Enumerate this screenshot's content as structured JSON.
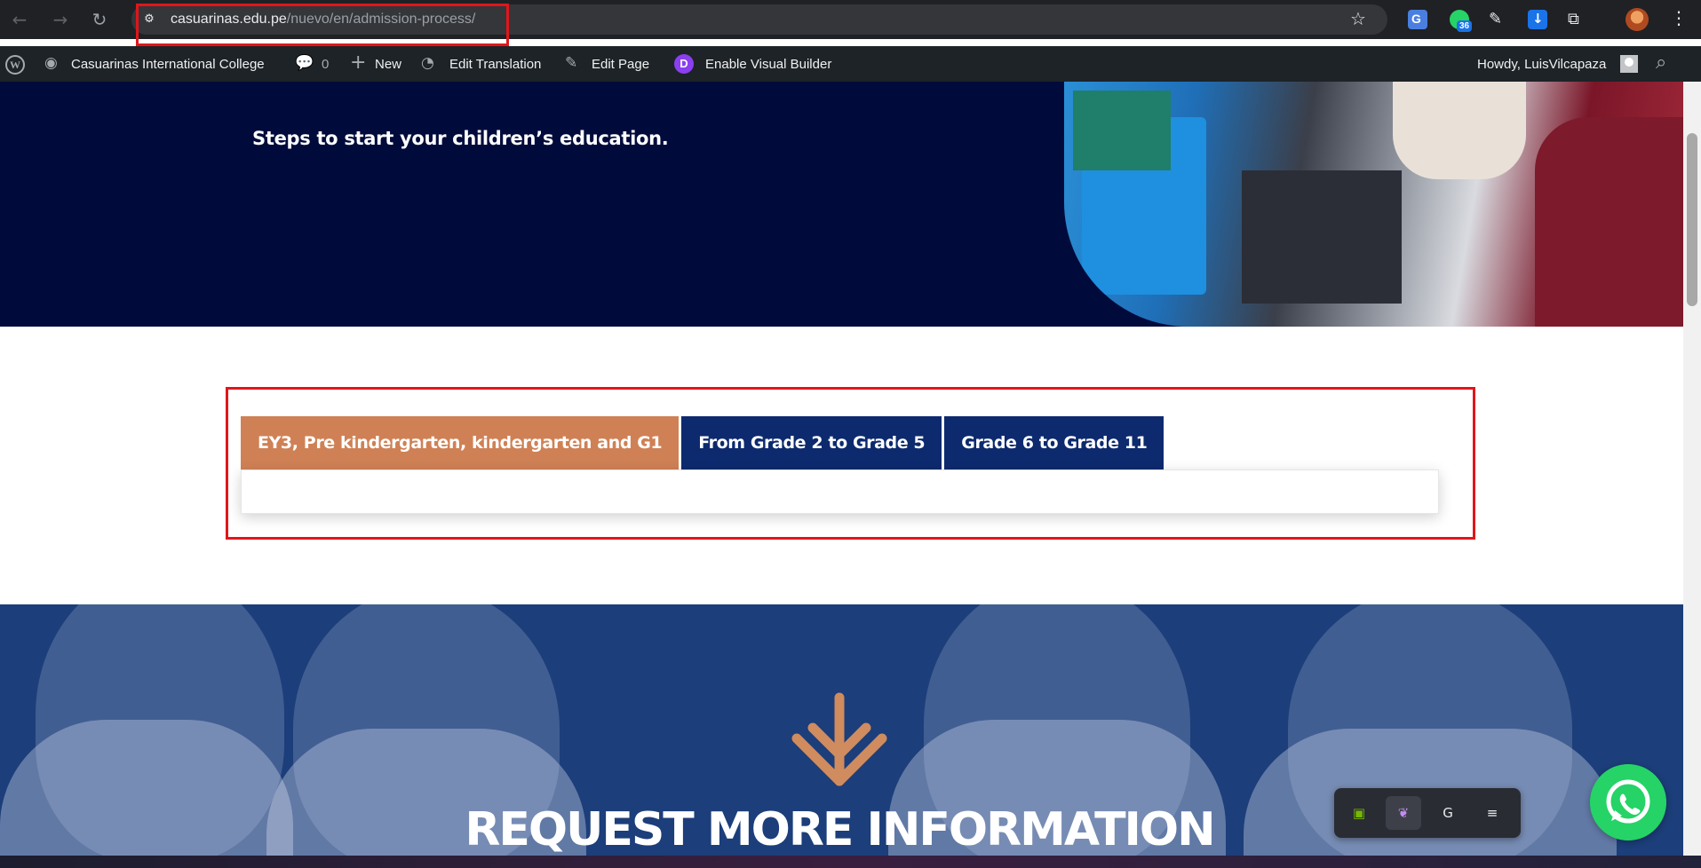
{
  "browser": {
    "url_host": "casuarinas.edu.pe",
    "url_path": "/nuevo/en/admission-process/",
    "back_icon": "←",
    "forward_icon": "→",
    "reload_icon": "↻",
    "site_info_icon": "⚙",
    "bookmark_icon": "☆",
    "extension_badge": "36",
    "pen_icon": "✎",
    "puzzle_icon": "⧉",
    "menu_icon": "⋮"
  },
  "admin_bar": {
    "wp_logo": "W",
    "site_name": "Casuarinas International College",
    "comments_count": "0",
    "new_label": "New",
    "edit_translation_label": "Edit Translation",
    "edit_page_label": "Edit Page",
    "divi_badge": "D",
    "visual_builder_label": "Enable Visual Builder",
    "greeting": "Howdy, LuisVilcapaza",
    "comment_icon": "💬",
    "plus_icon": "+",
    "translate_icon": "◔",
    "pencil_icon": "✎",
    "search_icon": "⌕"
  },
  "hero": {
    "subtitle": "Steps to start your children’s education."
  },
  "tabs": {
    "items": [
      {
        "label": "EY3, Pre kindergarten, kindergarten and G1",
        "active": true
      },
      {
        "label": "From Grade 2 to Grade 5",
        "active": false
      },
      {
        "label": "Grade 6 to Grade 11",
        "active": false
      }
    ]
  },
  "request": {
    "title": "REQUEST MORE INFORMATION"
  },
  "tray": {
    "nvidia_icon": "▣",
    "feather_icon": "❦",
    "g_icon": "G",
    "queue_icon": "≡"
  },
  "colors": {
    "hero_bg": "#010b3b",
    "tab_active": "#cf8155",
    "tab_inactive": "#0d2a6e",
    "accent_orange": "#d08b5e",
    "whatsapp": "#25d366",
    "highlight_red": "#e0161b"
  }
}
